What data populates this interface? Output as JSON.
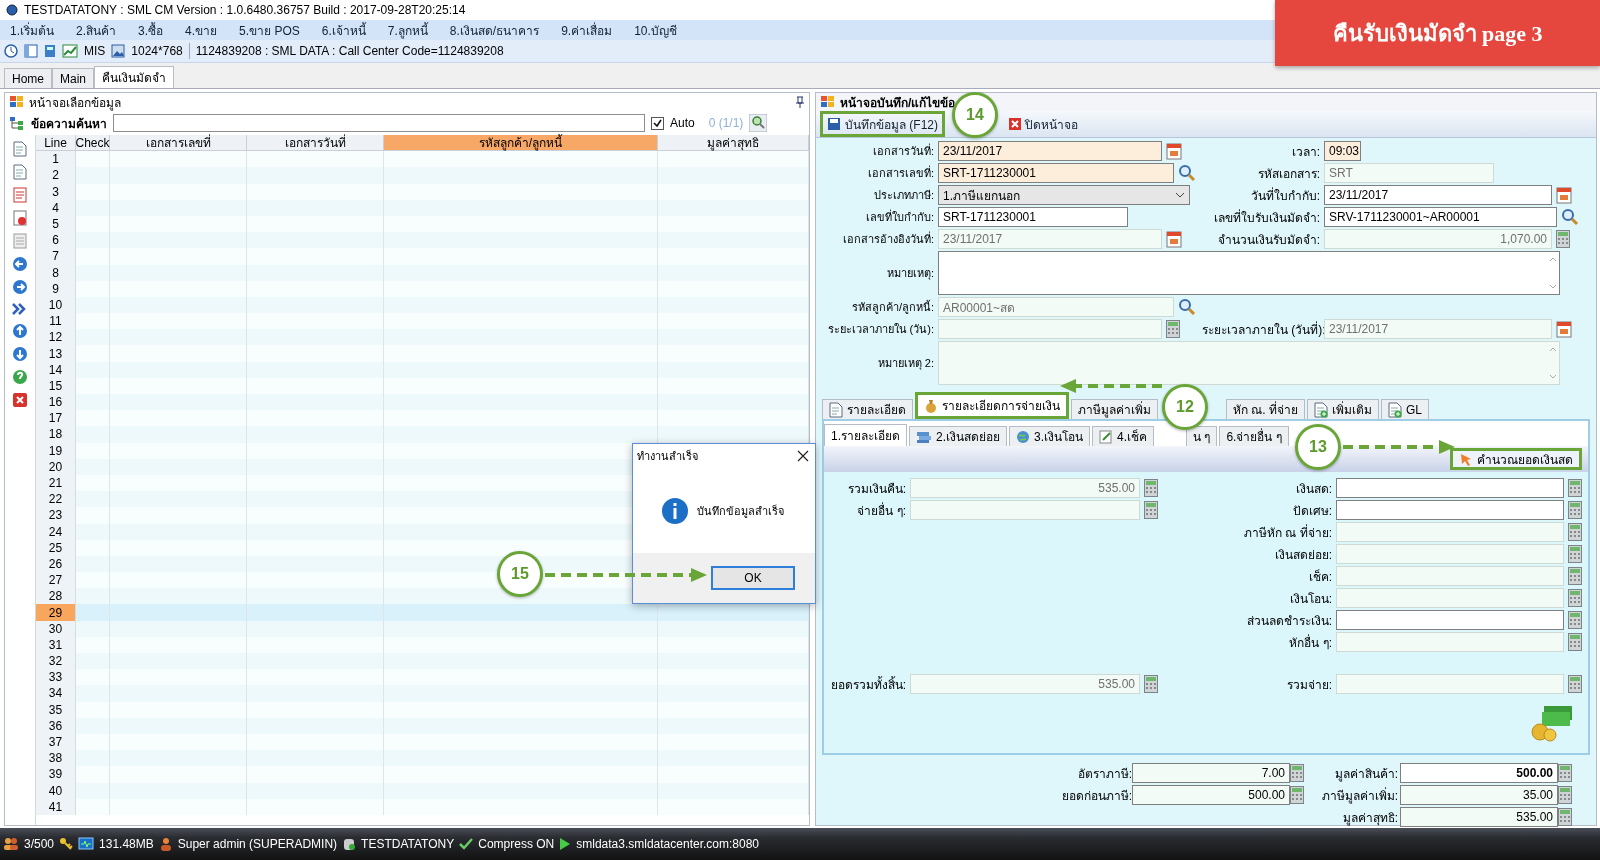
{
  "window": {
    "title": "TESTDATATONY : SML CM Version : 1.0.6480.36757  Build : 2017-09-28T20:25:14"
  },
  "banner": "คืนรับเงินมัดจำ page 3",
  "menu": [
    "1.เริ่มต้น",
    "2.สินค้า",
    "3.ซื้อ",
    "4.ขาย",
    "5.ขาย POS",
    "6.เจ้าหนี้",
    "7.ลูกหนี้",
    "8.เงินสด/ธนาคาร",
    "9.ค่าเสื่อม",
    "10.บัญชี"
  ],
  "toolbar": {
    "mis": "MIS",
    "resolution": "1024*768",
    "info": "1124839208 : SML DATA : Call Center Code=1124839208"
  },
  "tabs": [
    {
      "label": "Home",
      "selected": false
    },
    {
      "label": "Main",
      "selected": false
    },
    {
      "label": "คืนเงินมัดจำ",
      "selected": true
    }
  ],
  "list_panel": {
    "title": "หน้าจอเลือกข้อมูล",
    "search_label": "ข้อความค้นหา",
    "auto": {
      "label": "Auto",
      "checked": true
    },
    "count": "0 (1/1)",
    "columns": [
      {
        "label": "Line",
        "sorted": false
      },
      {
        "label": "Check",
        "sorted": false
      },
      {
        "label": "เอกสารเลขที่",
        "sorted": false
      },
      {
        "label": "เอกสารวันที่",
        "sorted": false
      },
      {
        "label": "รหัสลูกค้า/ลูกหนี้",
        "sorted": true
      },
      {
        "label": "มูลค่าสุทธิ",
        "sorted": false
      }
    ],
    "rows": [
      {
        "line": "1",
        "selected": false
      },
      {
        "line": "2",
        "selected": false
      },
      {
        "line": "3",
        "selected": false
      },
      {
        "line": "4",
        "selected": false
      },
      {
        "line": "5",
        "selected": false
      },
      {
        "line": "6",
        "selected": false
      },
      {
        "line": "7",
        "selected": false
      },
      {
        "line": "8",
        "selected": false
      },
      {
        "line": "9",
        "selected": false
      },
      {
        "line": "10",
        "selected": false
      },
      {
        "line": "11",
        "selected": false
      },
      {
        "line": "12",
        "selected": false
      },
      {
        "line": "13",
        "selected": false
      },
      {
        "line": "14",
        "selected": false
      },
      {
        "line": "15",
        "selected": false
      },
      {
        "line": "16",
        "selected": false
      },
      {
        "line": "17",
        "selected": false
      },
      {
        "line": "18",
        "selected": false
      },
      {
        "line": "19",
        "selected": false
      },
      {
        "line": "20",
        "selected": false
      },
      {
        "line": "21",
        "selected": false
      },
      {
        "line": "22",
        "selected": false
      },
      {
        "line": "23",
        "selected": false
      },
      {
        "line": "24",
        "selected": false
      },
      {
        "line": "25",
        "selected": false
      },
      {
        "line": "26",
        "selected": false
      },
      {
        "line": "27",
        "selected": false
      },
      {
        "line": "28",
        "selected": false
      },
      {
        "line": "29",
        "selected": true
      },
      {
        "line": "30",
        "selected": false
      },
      {
        "line": "31",
        "selected": false
      },
      {
        "line": "32",
        "selected": false
      },
      {
        "line": "33",
        "selected": false
      },
      {
        "line": "34",
        "selected": false
      },
      {
        "line": "35",
        "selected": false
      },
      {
        "line": "36",
        "selected": false
      },
      {
        "line": "37",
        "selected": false
      },
      {
        "line": "38",
        "selected": false
      },
      {
        "line": "39",
        "selected": false
      },
      {
        "line": "40",
        "selected": false
      },
      {
        "line": "41",
        "selected": false
      }
    ]
  },
  "edit_panel": {
    "title": "หน้าจอบันทึก/แก้ไขข้อ",
    "buttons": [
      {
        "label": "บันทึกข้อมูล (F12)",
        "highlighted": true
      },
      {
        "label": "ปิดหน้าจอ",
        "highlighted": false
      }
    ],
    "rows": [
      {
        "left": {
          "label": "เอกสารวันที่:",
          "kind": "date",
          "value": "23/11/2017",
          "required": true,
          "readonly": false
        },
        "right": {
          "label": "เวลา:",
          "kind": "time",
          "value": "09:03",
          "required": true,
          "readonly": false
        }
      },
      {
        "left": {
          "label": "เอกสารเลขที่:",
          "kind": "lookup",
          "value": "SRT-1711230001",
          "required": true,
          "readonly": false
        },
        "right": {
          "label": "รหัสเอกสาร:",
          "kind": "text",
          "value": "SRT",
          "required": false,
          "readonly": true
        }
      },
      {
        "left": {
          "label": "ประเภทภาษี:",
          "kind": "select",
          "value": "1.ภาษีแยกนอก",
          "required": false,
          "readonly": false
        },
        "right": {
          "label": "วันที่ใบกำกับ:",
          "kind": "date",
          "value": "23/11/2017",
          "required": false,
          "readonly": false
        }
      },
      {
        "left": {
          "label": "เลขที่ใบกำกับ:",
          "kind": "text",
          "value": "SRT-1711230001",
          "required": false,
          "readonly": false
        },
        "right": {
          "label": "เลขที่ใบรับเงินมัดจำ:",
          "kind": "lookup",
          "value": "SRV-1711230001~AR00001",
          "required": false,
          "readonly": false
        }
      },
      {
        "left": {
          "label": "เอกสารอ้างอิงวันที่:",
          "kind": "date",
          "value": "23/11/2017",
          "required": false,
          "readonly": true
        },
        "right": {
          "label": "จำนวนเงินรับมัดจำ:",
          "kind": "number",
          "value": "1,070.00",
          "required": false,
          "readonly": true
        }
      },
      {
        "left": {
          "label": "หมายเหตุ:",
          "kind": "memo",
          "required": false,
          "readonly": false
        }
      },
      {
        "left": {
          "label": "รหัสลูกค้า/ลูกหนี้:",
          "kind": "lookup",
          "value": "AR00001~สด",
          "required": false,
          "readonly": true
        }
      },
      {
        "left": {
          "label": "ระยะเวลาภายใน (วัน):",
          "kind": "number",
          "required": false,
          "readonly": true
        },
        "right": {
          "label": "ระยะเวลาภายใน (วันที่):",
          "kind": "date",
          "value": "23/11/2017",
          "required": false,
          "readonly": true
        }
      },
      {
        "left": {
          "label": "หมายเหตุ 2:",
          "kind": "memo",
          "required": false,
          "readonly": true
        }
      }
    ]
  },
  "payment": {
    "tabs": [
      {
        "label": "รายละเอียด",
        "selected": false,
        "highlighted": false
      },
      {
        "label": "รายละเอียดการจ่ายเงิน",
        "selected": true,
        "highlighted": true
      },
      {
        "label": "ภาษีมูลค่าเพิ่ม",
        "selected": false,
        "highlighted": false
      },
      {
        "label": "หัก ณ. ที่จ่าย",
        "selected": false,
        "highlighted": false
      },
      {
        "label": "เพิ่มเติม",
        "selected": false,
        "highlighted": false
      },
      {
        "label": "GL",
        "selected": false,
        "highlighted": false
      }
    ],
    "subtabs": [
      {
        "label": "1.รายละเอียด",
        "selected": true
      },
      {
        "label": "2.เงินสดย่อย",
        "selected": false
      },
      {
        "label": "3.เงินโอน",
        "selected": false
      },
      {
        "label": "4.เช็ค",
        "selected": false
      },
      {
        "label": "น ๆ",
        "selected": false
      },
      {
        "label": "6.จ่ายอื่น ๆ",
        "selected": false
      }
    ],
    "calc_button": {
      "label": "คำนวณยอดเงินสด",
      "highlighted": true
    },
    "left": [
      {
        "label": "รวมเงินคืน:",
        "value": "535.00",
        "readonly": true
      },
      {
        "label": "จ่ายอื่น ๆ:",
        "readonly": true
      }
    ],
    "right": [
      {
        "label": "เงินสด:",
        "readonly": false
      },
      {
        "label": "ปัดเศษ:",
        "readonly": false
      },
      {
        "label": "ภาษีหัก ณ ที่จ่าย:",
        "readonly": true
      },
      {
        "label": "เงินสดย่อย:",
        "readonly": true
      },
      {
        "label": "เช็ค:",
        "readonly": true
      },
      {
        "label": "เงินโอน:",
        "readonly": true
      },
      {
        "label": "ส่วนลดชำระเงิน:",
        "readonly": false
      },
      {
        "label": "หักอื่น ๆ:",
        "readonly": true
      }
    ],
    "total_left": {
      "label": "ยอดรวมทั้งสิ้น:",
      "value": "535.00",
      "readonly": true
    },
    "total_right": {
      "label": "รวมจ่าย:",
      "readonly": true
    }
  },
  "summary": {
    "left": [
      {
        "label": "อัตราภาษี:",
        "value": "7.00",
        "readonly": true
      },
      {
        "label": "ยอดก่อนภาษี:",
        "value": "500.00",
        "readonly": true
      }
    ],
    "right": [
      {
        "label": "มูลค่าสินค้า:",
        "value": "500.00",
        "readonly": false
      },
      {
        "label": "ภาษีมูลค่าเพิ่ม:",
        "value": "35.00",
        "readonly": true
      },
      {
        "label": "มูลค่าสุทธิ:",
        "value": "535.00",
        "readonly": true
      }
    ]
  },
  "dialog": {
    "title": "ทำงานสำเร็จ",
    "message": "บันทึกข้อมูลสำเร็จ",
    "button": "OK"
  },
  "annotations": [
    {
      "number": "14"
    },
    {
      "number": "12"
    },
    {
      "number": "13"
    },
    {
      "number": "15"
    }
  ],
  "status_bar": [
    "3/500",
    "131.48MB",
    "Super admin (SUPERADMIN)",
    "TESTDATATONY",
    "Compress ON",
    "smldata3.smldatacenter.com:8080"
  ]
}
